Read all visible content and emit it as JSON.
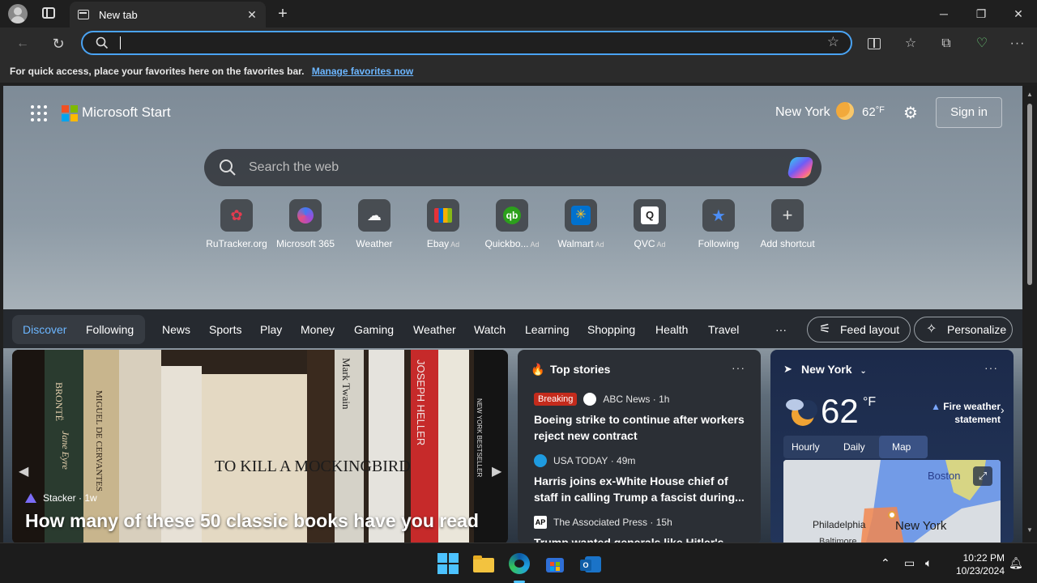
{
  "browser": {
    "tab_title": "New tab",
    "address_value": "",
    "favorites_hint": "For quick access, place your favorites here on the favorites bar.",
    "favorites_link": "Manage favorites now"
  },
  "header": {
    "brand": "Microsoft Start",
    "location": "New York",
    "temperature": "62",
    "temp_unit": "°F",
    "signin": "Sign in"
  },
  "search": {
    "placeholder": "Search the web"
  },
  "shortcuts": [
    {
      "label": "RuTracker.org",
      "ad": ""
    },
    {
      "label": "Microsoft 365",
      "ad": ""
    },
    {
      "label": "Weather",
      "ad": ""
    },
    {
      "label": "Ebay",
      "ad": "Ad"
    },
    {
      "label": "Quickbo...",
      "ad": "Ad"
    },
    {
      "label": "Walmart",
      "ad": "Ad"
    },
    {
      "label": "QVC",
      "ad": "Ad"
    },
    {
      "label": "Following",
      "ad": ""
    },
    {
      "label": "Add shortcut",
      "ad": ""
    }
  ],
  "nav": {
    "discover": "Discover",
    "following": "Following",
    "items": [
      "News",
      "Sports",
      "Play",
      "Money",
      "Gaming",
      "Weather",
      "Watch",
      "Learning",
      "Shopping",
      "Health",
      "Travel"
    ],
    "more": "···",
    "feed_layout": "Feed layout",
    "personalize": "Personalize"
  },
  "hero": {
    "source": "Stacker",
    "age": "1w",
    "title": "How many of these 50 classic books have you read",
    "spines": [
      "BRONTË",
      "Jane Eyre",
      "MIGUEL DE CERVANTES",
      "TO KILL A MOCKINGBIRD",
      "Mark Twain",
      "JOSEPH HELLER",
      "NEW YORK BESTSELLER"
    ]
  },
  "top_stories": {
    "heading": "Top stories",
    "items": [
      {
        "badge": "Breaking",
        "source": "ABC News",
        "age": "1h",
        "title": "Boeing strike to continue after workers reject new contract"
      },
      {
        "badge": "",
        "source": "USA TODAY",
        "age": "49m",
        "title": "Harris joins ex-White House chief of staff in calling Trump a fascist during..."
      },
      {
        "badge": "",
        "source": "The Associated Press",
        "age": "15h",
        "title": "Trump wanted generals like Hitler's and..."
      }
    ]
  },
  "weather": {
    "location": "New York",
    "temp": "62",
    "unit": "°F",
    "alert": "Fire weather statement",
    "tabs": [
      "Hourly",
      "Daily",
      "Map"
    ],
    "active_tab": "Map",
    "map_labels": [
      "Boston",
      "Philadelphia",
      "New York",
      "Baltimore"
    ]
  },
  "taskbar": {
    "time": "10:22 PM",
    "date": "10/23/2024"
  },
  "colors": {
    "accent": "#4aa3f3",
    "link": "#6cb6ff",
    "breaking": "#c42b1c",
    "discover": "#6cb6ff"
  }
}
